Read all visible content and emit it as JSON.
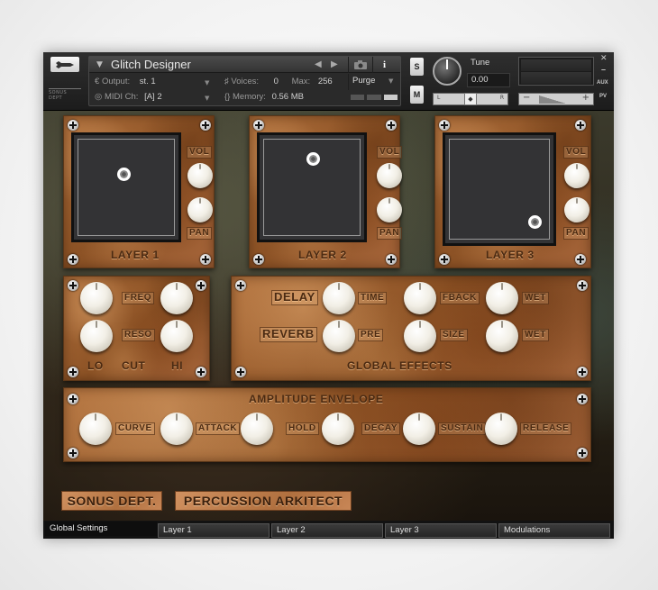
{
  "header": {
    "instrument_name": "Glitch Designer",
    "output_label": "Output:",
    "output_value": "st. 1",
    "voices_label": "Voices:",
    "voices_value": "0",
    "max_label": "Max:",
    "max_value": "256",
    "purge_label": "Purge",
    "midi_label": "MIDI Ch:",
    "midi_value": "[A]  2",
    "memory_label": "Memory:",
    "memory_value": "0.56 MB",
    "solo_label": "S",
    "mute_label": "M",
    "tune_label": "Tune",
    "tune_value": "0.00",
    "pan_l": "L",
    "pan_r": "R",
    "aux_label": "AUX",
    "pv_label": "PV"
  },
  "layers": [
    {
      "title": "LAYER 1",
      "vol_label": "VOL",
      "pan_label": "PAN",
      "xy": [
        0.5,
        0.38
      ]
    },
    {
      "title": "LAYER 2",
      "vol_label": "VOL",
      "pan_label": "PAN",
      "xy": [
        0.55,
        0.2
      ]
    },
    {
      "title": "LAYER 3",
      "vol_label": "VOL",
      "pan_label": "PAN",
      "xy": [
        0.93,
        0.9
      ]
    }
  ],
  "filter": {
    "freq_label": "FREQ",
    "reso_label": "RESO",
    "lo_label": "LO",
    "cut_label": "CUT",
    "hi_label": "HI"
  },
  "global_effects": {
    "title": "GLOBAL EFFECTS",
    "delay_label": "DELAY",
    "reverb_label": "REVERB",
    "time_label": "TIME",
    "fback_label": "FBACK",
    "delay_wet_label": "WET",
    "pre_label": "PRE",
    "size_label": "SIZE",
    "reverb_wet_label": "WET"
  },
  "envelope": {
    "title": "AMPLITUDE ENVELOPE",
    "curve_label": "CURVE",
    "attack_label": "ATTACK",
    "hold_label": "HOLD",
    "decay_label": "DECAY",
    "sustain_label": "SUSTAIN",
    "release_label": "RELEASE"
  },
  "branding": {
    "company": "SONUS DEPT.",
    "product": "PERCUSSION ARKITECT"
  },
  "tabs": [
    {
      "label": "Global Settings",
      "active": true
    },
    {
      "label": "Layer 1",
      "active": false
    },
    {
      "label": "Layer 2",
      "active": false
    },
    {
      "label": "Layer 3",
      "active": false
    },
    {
      "label": "Modulations",
      "active": false
    }
  ]
}
